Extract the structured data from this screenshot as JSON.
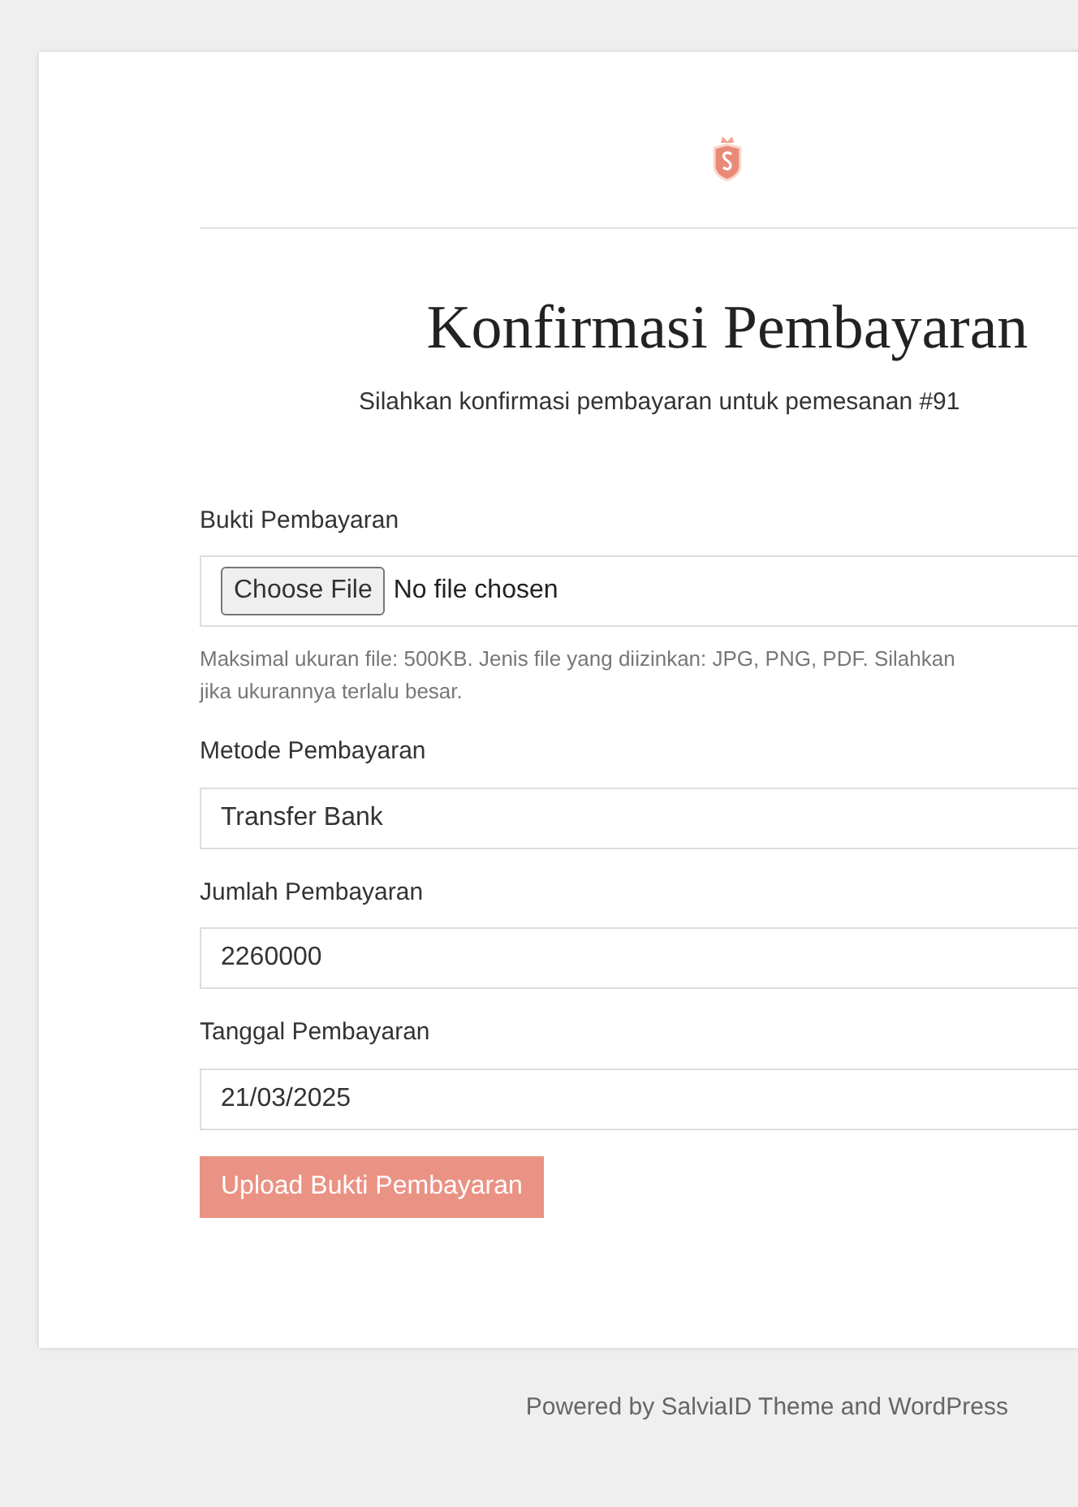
{
  "title": "Konfirmasi Pembayaran",
  "subtitle": "Silahkan konfirmasi pembayaran untuk pemesanan #91",
  "file_field": {
    "label": "Bukti Pembayaran",
    "button": "Choose File",
    "status": "No file chosen",
    "hint_lines": [
      "Maksimal ukuran file: 500KB. Jenis file yang diizinkan: JPG, PNG, PDF. Silahkan",
      "jika ukurannya terlalu besar."
    ]
  },
  "fields": [
    {
      "label": "Metode Pembayaran",
      "value": "Transfer Bank"
    },
    {
      "label": "Jumlah Pembayaran",
      "value": "2260000"
    },
    {
      "label": "Tanggal Pembayaran",
      "value": "21/03/2025"
    }
  ],
  "submit": "Upload Bukti Pembayaran",
  "footer": "Powered by SalviaID Theme and WordPress"
}
